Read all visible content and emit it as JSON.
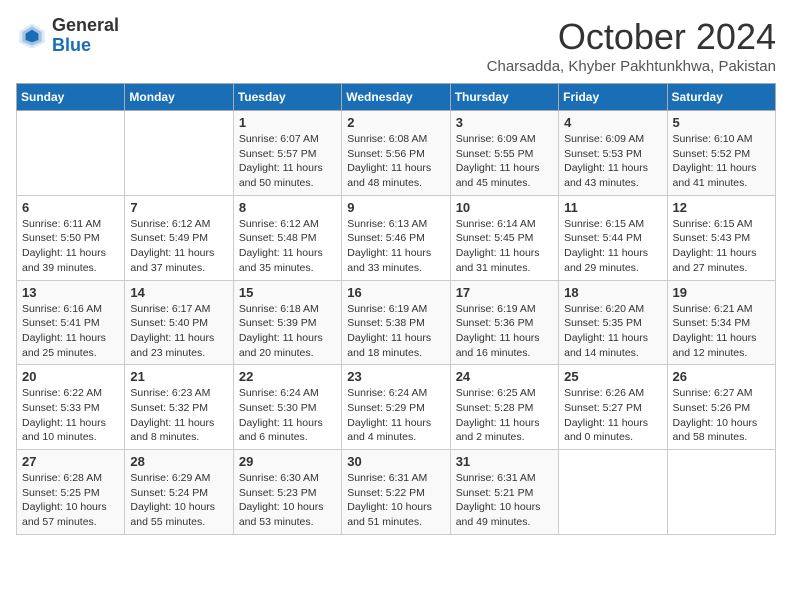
{
  "header": {
    "logo_general": "General",
    "logo_blue": "Blue",
    "title": "October 2024",
    "subtitle": "Charsadda, Khyber Pakhtunkhwa, Pakistan"
  },
  "days_of_week": [
    "Sunday",
    "Monday",
    "Tuesday",
    "Wednesday",
    "Thursday",
    "Friday",
    "Saturday"
  ],
  "weeks": [
    [
      {
        "day": "",
        "sunrise": "",
        "sunset": "",
        "daylight": ""
      },
      {
        "day": "",
        "sunrise": "",
        "sunset": "",
        "daylight": ""
      },
      {
        "day": "1",
        "sunrise": "Sunrise: 6:07 AM",
        "sunset": "Sunset: 5:57 PM",
        "daylight": "Daylight: 11 hours and 50 minutes."
      },
      {
        "day": "2",
        "sunrise": "Sunrise: 6:08 AM",
        "sunset": "Sunset: 5:56 PM",
        "daylight": "Daylight: 11 hours and 48 minutes."
      },
      {
        "day": "3",
        "sunrise": "Sunrise: 6:09 AM",
        "sunset": "Sunset: 5:55 PM",
        "daylight": "Daylight: 11 hours and 45 minutes."
      },
      {
        "day": "4",
        "sunrise": "Sunrise: 6:09 AM",
        "sunset": "Sunset: 5:53 PM",
        "daylight": "Daylight: 11 hours and 43 minutes."
      },
      {
        "day": "5",
        "sunrise": "Sunrise: 6:10 AM",
        "sunset": "Sunset: 5:52 PM",
        "daylight": "Daylight: 11 hours and 41 minutes."
      }
    ],
    [
      {
        "day": "6",
        "sunrise": "Sunrise: 6:11 AM",
        "sunset": "Sunset: 5:50 PM",
        "daylight": "Daylight: 11 hours and 39 minutes."
      },
      {
        "day": "7",
        "sunrise": "Sunrise: 6:12 AM",
        "sunset": "Sunset: 5:49 PM",
        "daylight": "Daylight: 11 hours and 37 minutes."
      },
      {
        "day": "8",
        "sunrise": "Sunrise: 6:12 AM",
        "sunset": "Sunset: 5:48 PM",
        "daylight": "Daylight: 11 hours and 35 minutes."
      },
      {
        "day": "9",
        "sunrise": "Sunrise: 6:13 AM",
        "sunset": "Sunset: 5:46 PM",
        "daylight": "Daylight: 11 hours and 33 minutes."
      },
      {
        "day": "10",
        "sunrise": "Sunrise: 6:14 AM",
        "sunset": "Sunset: 5:45 PM",
        "daylight": "Daylight: 11 hours and 31 minutes."
      },
      {
        "day": "11",
        "sunrise": "Sunrise: 6:15 AM",
        "sunset": "Sunset: 5:44 PM",
        "daylight": "Daylight: 11 hours and 29 minutes."
      },
      {
        "day": "12",
        "sunrise": "Sunrise: 6:15 AM",
        "sunset": "Sunset: 5:43 PM",
        "daylight": "Daylight: 11 hours and 27 minutes."
      }
    ],
    [
      {
        "day": "13",
        "sunrise": "Sunrise: 6:16 AM",
        "sunset": "Sunset: 5:41 PM",
        "daylight": "Daylight: 11 hours and 25 minutes."
      },
      {
        "day": "14",
        "sunrise": "Sunrise: 6:17 AM",
        "sunset": "Sunset: 5:40 PM",
        "daylight": "Daylight: 11 hours and 23 minutes."
      },
      {
        "day": "15",
        "sunrise": "Sunrise: 6:18 AM",
        "sunset": "Sunset: 5:39 PM",
        "daylight": "Daylight: 11 hours and 20 minutes."
      },
      {
        "day": "16",
        "sunrise": "Sunrise: 6:19 AM",
        "sunset": "Sunset: 5:38 PM",
        "daylight": "Daylight: 11 hours and 18 minutes."
      },
      {
        "day": "17",
        "sunrise": "Sunrise: 6:19 AM",
        "sunset": "Sunset: 5:36 PM",
        "daylight": "Daylight: 11 hours and 16 minutes."
      },
      {
        "day": "18",
        "sunrise": "Sunrise: 6:20 AM",
        "sunset": "Sunset: 5:35 PM",
        "daylight": "Daylight: 11 hours and 14 minutes."
      },
      {
        "day": "19",
        "sunrise": "Sunrise: 6:21 AM",
        "sunset": "Sunset: 5:34 PM",
        "daylight": "Daylight: 11 hours and 12 minutes."
      }
    ],
    [
      {
        "day": "20",
        "sunrise": "Sunrise: 6:22 AM",
        "sunset": "Sunset: 5:33 PM",
        "daylight": "Daylight: 11 hours and 10 minutes."
      },
      {
        "day": "21",
        "sunrise": "Sunrise: 6:23 AM",
        "sunset": "Sunset: 5:32 PM",
        "daylight": "Daylight: 11 hours and 8 minutes."
      },
      {
        "day": "22",
        "sunrise": "Sunrise: 6:24 AM",
        "sunset": "Sunset: 5:30 PM",
        "daylight": "Daylight: 11 hours and 6 minutes."
      },
      {
        "day": "23",
        "sunrise": "Sunrise: 6:24 AM",
        "sunset": "Sunset: 5:29 PM",
        "daylight": "Daylight: 11 hours and 4 minutes."
      },
      {
        "day": "24",
        "sunrise": "Sunrise: 6:25 AM",
        "sunset": "Sunset: 5:28 PM",
        "daylight": "Daylight: 11 hours and 2 minutes."
      },
      {
        "day": "25",
        "sunrise": "Sunrise: 6:26 AM",
        "sunset": "Sunset: 5:27 PM",
        "daylight": "Daylight: 11 hours and 0 minutes."
      },
      {
        "day": "26",
        "sunrise": "Sunrise: 6:27 AM",
        "sunset": "Sunset: 5:26 PM",
        "daylight": "Daylight: 10 hours and 58 minutes."
      }
    ],
    [
      {
        "day": "27",
        "sunrise": "Sunrise: 6:28 AM",
        "sunset": "Sunset: 5:25 PM",
        "daylight": "Daylight: 10 hours and 57 minutes."
      },
      {
        "day": "28",
        "sunrise": "Sunrise: 6:29 AM",
        "sunset": "Sunset: 5:24 PM",
        "daylight": "Daylight: 10 hours and 55 minutes."
      },
      {
        "day": "29",
        "sunrise": "Sunrise: 6:30 AM",
        "sunset": "Sunset: 5:23 PM",
        "daylight": "Daylight: 10 hours and 53 minutes."
      },
      {
        "day": "30",
        "sunrise": "Sunrise: 6:31 AM",
        "sunset": "Sunset: 5:22 PM",
        "daylight": "Daylight: 10 hours and 51 minutes."
      },
      {
        "day": "31",
        "sunrise": "Sunrise: 6:31 AM",
        "sunset": "Sunset: 5:21 PM",
        "daylight": "Daylight: 10 hours and 49 minutes."
      },
      {
        "day": "",
        "sunrise": "",
        "sunset": "",
        "daylight": ""
      },
      {
        "day": "",
        "sunrise": "",
        "sunset": "",
        "daylight": ""
      }
    ]
  ]
}
